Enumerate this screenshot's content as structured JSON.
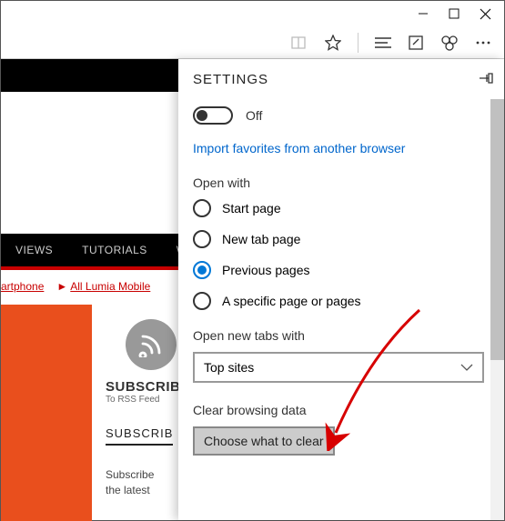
{
  "window": {
    "minimize_icon": "minimize",
    "maximize_icon": "maximize",
    "close_icon": "close"
  },
  "toolbar": {
    "reading": "reading-list",
    "favorite": "star",
    "hub": "hub",
    "note": "web-note",
    "share": "share",
    "more": "more"
  },
  "background": {
    "nav": {
      "item1": "VIEWS",
      "item2": "TUTORIALS",
      "item3": "WIND"
    },
    "redlinks": {
      "l1": "artphone",
      "l2": "All Lumia Mobile"
    },
    "subscribe": {
      "title": "SUBSCRIB",
      "caption": "To RSS Feed",
      "second_title": "SUBSCRIB",
      "text1": "Subscribe",
      "text2": "the latest"
    }
  },
  "settings": {
    "title": "SETTINGS",
    "toggle_label": "Off",
    "import_link": "Import favorites from another browser",
    "open_with": {
      "label": "Open with",
      "opt1": "Start page",
      "opt2": "New tab page",
      "opt3": "Previous pages",
      "opt4": "A specific page or pages",
      "selected": "opt3"
    },
    "open_new_tabs": {
      "label": "Open new tabs with",
      "value": "Top sites"
    },
    "clear": {
      "label": "Clear browsing data",
      "button": "Choose what to clear"
    }
  }
}
